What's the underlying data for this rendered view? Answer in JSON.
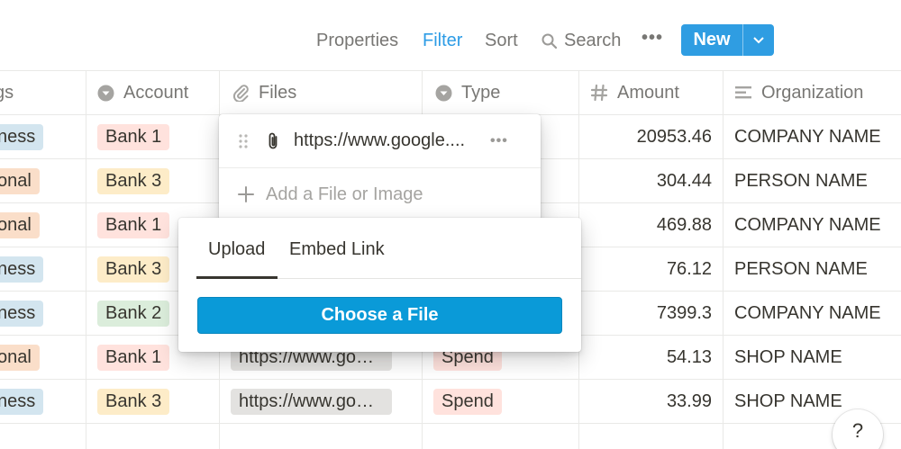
{
  "toolbar": {
    "properties": "Properties",
    "filter": "Filter",
    "sort": "Sort",
    "search": "Search",
    "more": "•••",
    "new": "New"
  },
  "columns": {
    "tags": "gs",
    "account": "Account",
    "files": "Files",
    "type": "Type",
    "amount": "Amount",
    "organization": "Organization"
  },
  "rows": [
    {
      "tag": "ness",
      "account": "Bank 1",
      "file": "",
      "type": "",
      "amount": "20953.46",
      "organization": "COMPANY NAME"
    },
    {
      "tag": "onal",
      "account": "Bank 3",
      "file": "",
      "type": "",
      "amount": "304.44",
      "organization": "PERSON NAME"
    },
    {
      "tag": "onal",
      "account": "Bank 1",
      "file": "",
      "type": "",
      "amount": "469.88",
      "organization": "COMPANY NAME"
    },
    {
      "tag": "ness",
      "account": "Bank 3",
      "file": "",
      "type": "",
      "amount": "76.12",
      "organization": "PERSON NAME"
    },
    {
      "tag": "ness",
      "account": "Bank 2",
      "file": "",
      "type": "",
      "amount": "7399.3",
      "organization": "COMPANY NAME"
    },
    {
      "tag": "onal",
      "account": "Bank 1",
      "file": "https://www.go…",
      "type": "Spend",
      "amount": "54.13",
      "organization": "SHOP NAME"
    },
    {
      "tag": "ness",
      "account": "Bank 3",
      "file": "https://www.go…",
      "type": "Spend",
      "amount": "33.99",
      "organization": "SHOP NAME"
    }
  ],
  "colors": {
    "accent": "#2f9de2",
    "tag_business": "#d3e5ef",
    "tag_personal": "#fadec9",
    "bank1": "#ffe2dd",
    "bank2": "#dbeddb",
    "bank3": "#fdecc8",
    "spend": "#ffe2dd",
    "file_pill": "#e3e2e0",
    "choose_button": "#0a9ad8"
  },
  "files_popover": {
    "url": "https://www.google....",
    "more": "•••",
    "add_label": "Add a File or Image"
  },
  "upload_popover": {
    "tab_upload": "Upload",
    "tab_embed": "Embed Link",
    "choose_button": "Choose a File"
  },
  "help": "?"
}
